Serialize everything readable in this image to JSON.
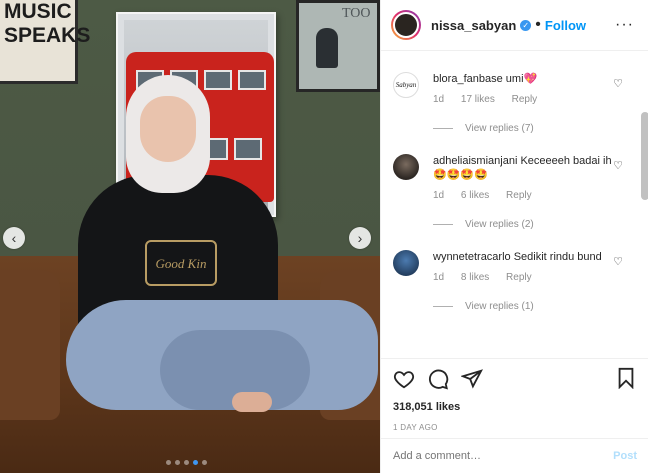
{
  "post": {
    "username": "nissa_sabyan",
    "follow_label": "Follow",
    "separator": "•",
    "more_label": "···"
  },
  "photo": {
    "poster_left_text": "MUSIC\nSPEAKS",
    "poster_right_text": "TOO",
    "shirt_print": "Good Kin",
    "carousel_total": 5,
    "carousel_active": 4
  },
  "comments": [
    {
      "avatar_text": "Sabyan",
      "username": "blora_fanbase",
      "text": "umi💖",
      "time": "1d",
      "likes": "17 likes",
      "reply_label": "Reply",
      "view_replies": "View replies (7)"
    },
    {
      "avatar_text": "",
      "username": "adheliaismianjani",
      "text": "Keceeeeh badai ih🤩🤩🤩🤩",
      "time": "1d",
      "likes": "6 likes",
      "reply_label": "Reply",
      "view_replies": "View replies (2)"
    },
    {
      "avatar_text": "",
      "username": "wynnetetracarlo",
      "text": "Sedikit rindu bund",
      "time": "1d",
      "likes": "8 likes",
      "reply_label": "Reply",
      "view_replies": "View replies (1)"
    }
  ],
  "actions": {
    "likes": "318,051 likes",
    "timestamp": "1 DAY AGO"
  },
  "composer": {
    "placeholder": "Add a comment…",
    "post_label": "Post"
  },
  "colors": {
    "link_blue": "#0095f6",
    "post_disabled": "#b2dffc",
    "muted": "#8e8e8e"
  },
  "icons": [
    "heart-icon",
    "comment-icon",
    "share-icon",
    "bookmark-icon",
    "verified-icon",
    "chevron-left-icon",
    "chevron-right-icon",
    "more-icon"
  ]
}
